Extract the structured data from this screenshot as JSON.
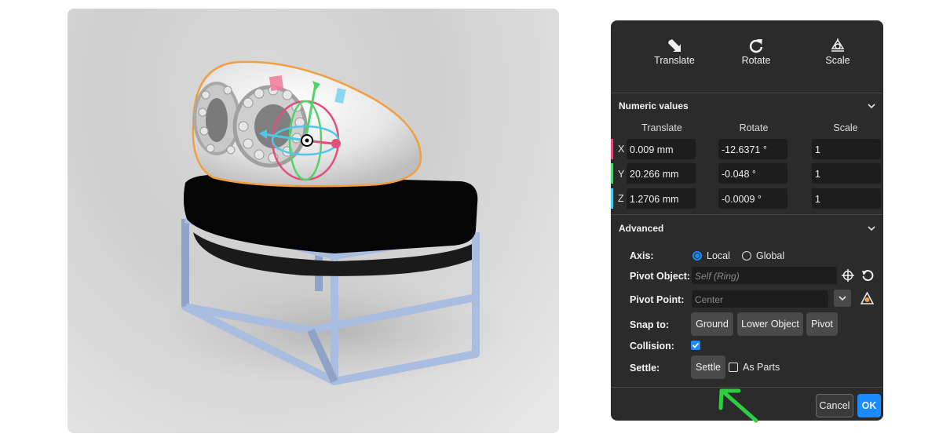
{
  "toolbar": {
    "items": [
      {
        "label": "Translate",
        "icon": "translate-arrow-icon"
      },
      {
        "label": "Rotate",
        "icon": "rotate-icon"
      },
      {
        "label": "Scale",
        "icon": "scale-icon"
      }
    ]
  },
  "numeric": {
    "title": "Numeric values",
    "columns": [
      "Translate",
      "Rotate",
      "Scale"
    ],
    "rows": [
      {
        "axis": "X",
        "translate": "0.009 mm",
        "rotate": "-12.6371 °",
        "scale": "1",
        "color": "#e0507a"
      },
      {
        "axis": "Y",
        "translate": "20.266 mm",
        "rotate": "-0.048 °",
        "scale": "1",
        "color": "#4fd46a"
      },
      {
        "axis": "Z",
        "translate": "1.2706 mm",
        "rotate": "-0.0009 °",
        "scale": "1",
        "color": "#4fc8e8"
      }
    ]
  },
  "advanced": {
    "title": "Advanced",
    "axis_label": "Axis:",
    "axis_options": [
      "Local",
      "Global"
    ],
    "axis_selected": "Local",
    "pivot_object_label": "Pivot Object:",
    "pivot_object_placeholder": "Self (Ring)",
    "pivot_point_label": "Pivot Point:",
    "pivot_point_value": "Center",
    "snap_label": "Snap to:",
    "snap_options": [
      "Ground",
      "Lower Object",
      "Pivot"
    ],
    "collision_label": "Collision:",
    "collision_checked": true,
    "settle_label": "Settle:",
    "settle_button": "Settle",
    "as_parts_label": "As Parts",
    "as_parts_checked": false
  },
  "footer": {
    "cancel": "Cancel",
    "ok": "OK"
  },
  "colors": {
    "accent": "#1a8cff",
    "panel_bg": "#2b2b2b",
    "annotation_arrow": "#2ecc40",
    "selection_outline": "#f0a040",
    "frame_color": "#a9bde0"
  }
}
